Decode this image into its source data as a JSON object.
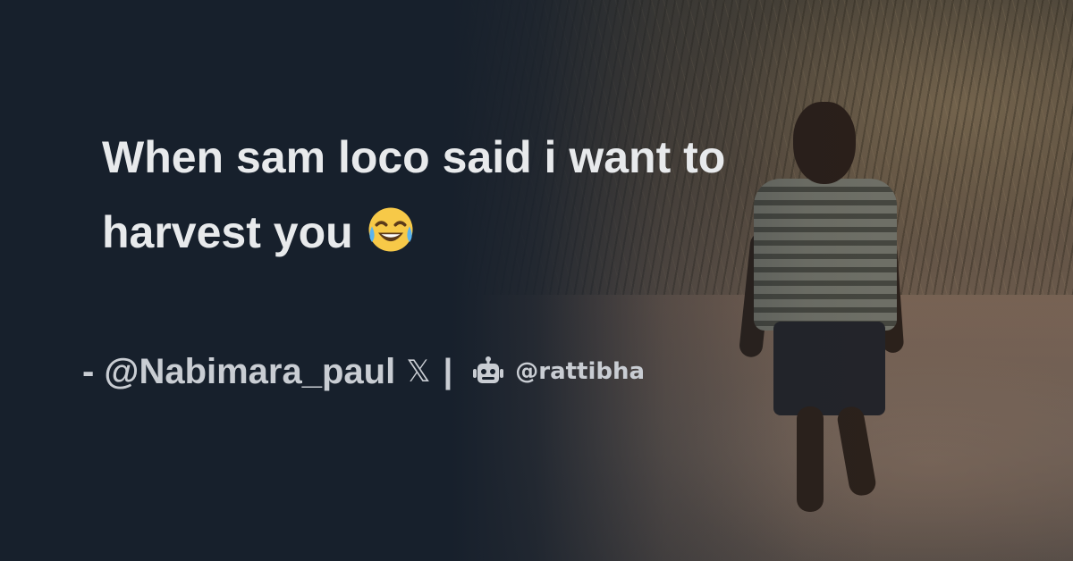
{
  "post": {
    "text": "When sam loco said i want to harvest you",
    "emoji": "face-with-tears-of-joy"
  },
  "attribution": {
    "author": "- @Nabimara_paul",
    "platform_icon": "x-logo-icon",
    "x_glyph": "𝕏",
    "separator": "|",
    "bot_icon": "robot-icon",
    "handle": "@rattibha"
  },
  "colors": {
    "background": "#17202c",
    "text": "#e8eaec",
    "muted_text": "#c9cdd3"
  }
}
